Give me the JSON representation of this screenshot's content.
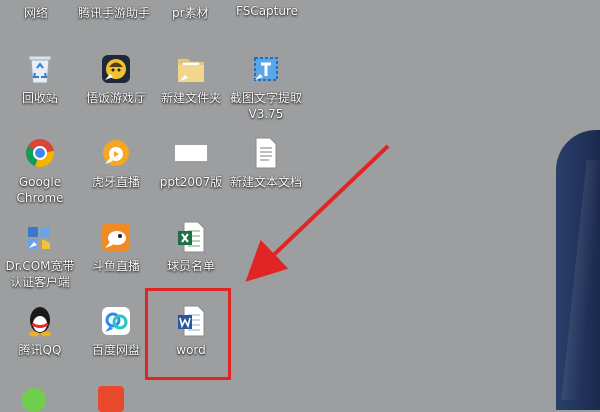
{
  "top_row": [
    "网络",
    "腾讯手游助手",
    "pr素材",
    "FSCapture"
  ],
  "icons": [
    {
      "label": "回收站",
      "icon": "recycle-bin-icon"
    },
    {
      "label": "悟饭游戏厅",
      "icon": "game-hall-icon"
    },
    {
      "label": "新建文件夹",
      "icon": "folder-icon"
    },
    {
      "label": "截图文字提取\nV3.75",
      "icon": "screenshot-ocr-icon"
    },
    {
      "label": "Google\nChrome",
      "icon": "chrome-icon"
    },
    {
      "label": "虎牙直播",
      "icon": "huya-icon"
    },
    {
      "label": "ppt2007版",
      "icon": "ppt-icon"
    },
    {
      "label": "新建文本文档",
      "icon": "text-document-icon"
    },
    {
      "label": "Dr.COM宽带\n认证客户端",
      "icon": "drcom-icon"
    },
    {
      "label": "斗鱼直播",
      "icon": "douyu-icon"
    },
    {
      "label": "球员名单",
      "icon": "excel-icon"
    },
    {
      "label": "腾讯QQ",
      "icon": "qq-icon"
    },
    {
      "label": "百度网盘",
      "icon": "baidu-netdisk-icon"
    },
    {
      "label": "word",
      "icon": "word-document-icon"
    }
  ],
  "colors": {
    "highlight": "#e12424",
    "desktop_bg": "#9c9ea0"
  }
}
